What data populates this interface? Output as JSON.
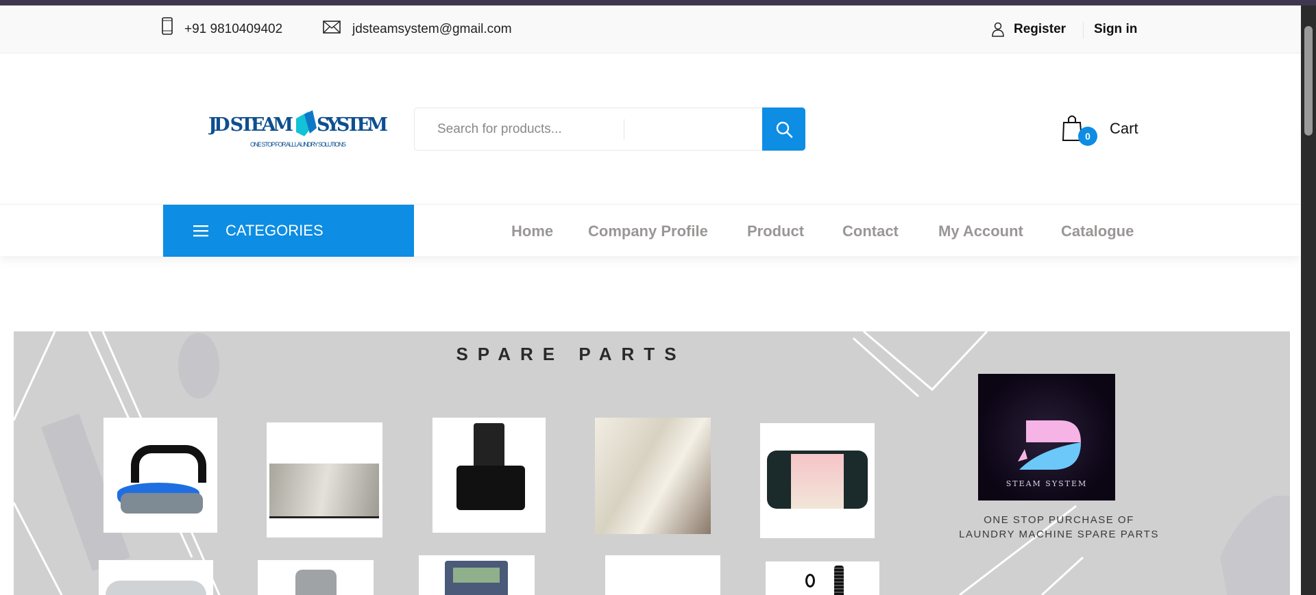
{
  "topbar": {
    "phone": "+91 9810409402",
    "email": "jdsteamsystem@gmail.com",
    "register": "Register",
    "signin": "Sign in"
  },
  "header": {
    "logo_text": "JD STEAM SYSTEM",
    "logo_tagline": "ONE STOP FOR ALL LAUNDRY SOLUTIONS",
    "search_placeholder": "Search for products...",
    "cart_label": "Cart",
    "cart_count": "0"
  },
  "nav": {
    "categories": "CATEGORIES",
    "items": [
      "Home",
      "Company Profile",
      "Product",
      "Contact",
      "My Account",
      "Catalogue"
    ]
  },
  "banner": {
    "title": "SPARE PARTS",
    "brand_logo_text": "STEAM SYSTEM",
    "tagline_1": "ONE STOP PURCHASE OF",
    "tagline_2": "LAUNDRY MACHINE SPARE PARTS"
  },
  "colors": {
    "accent": "#0d8de3",
    "nav_text": "#9a9696",
    "banner_bg": "#d0d0d0"
  },
  "icons": [
    "phone-icon",
    "mail-icon",
    "user-icon",
    "search-icon",
    "shopping-bag-icon",
    "hamburger-menu-icon"
  ]
}
